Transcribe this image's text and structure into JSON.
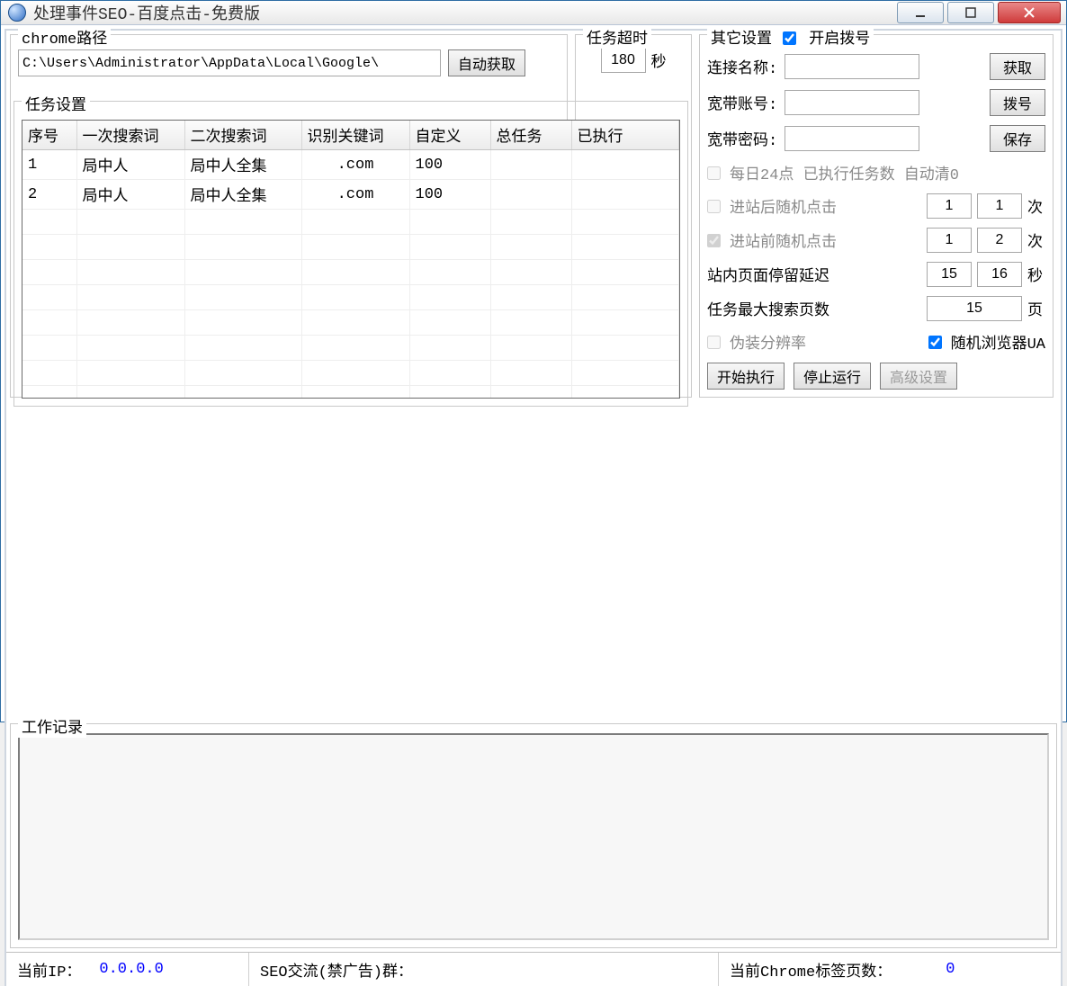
{
  "window": {
    "title": "处理事件SEO-百度点击-免费版"
  },
  "chrome": {
    "legend": "chrome路径",
    "path": "C:\\Users\\Administrator\\AppData\\Local\\Google\\",
    "auto_get": "自动获取"
  },
  "timeout": {
    "legend": "任务超时",
    "value": "180",
    "unit": "秒"
  },
  "other": {
    "legend": "其它设置",
    "enable_dial": "开启拨号",
    "conn_name_label": "连接名称:",
    "get_btn": "获取",
    "bb_account_label": "宽带账号:",
    "dial_btn": "拨号",
    "bb_pwd_label": "宽带密码:",
    "save_btn": "保存",
    "daily24": "每日24点 已执行任务数 自动清0",
    "after_enter_click": "进站后随机点击",
    "after_val1": "1",
    "after_val2": "1",
    "times_unit": "次",
    "before_enter_click": "进站前随机点击",
    "before_val1": "1",
    "before_val2": "2",
    "stay_delay_label": "站内页面停留延迟",
    "stay_val1": "15",
    "stay_val2": "16",
    "sec_unit": "秒",
    "page_unit": "页",
    "max_pages_label": "任务最大搜索页数",
    "max_pages_val": "15",
    "fake_res": "伪装分辨率",
    "random_ua": "随机浏览器UA",
    "start_btn": "开始执行",
    "stop_btn": "停止运行",
    "adv_btn": "高级设置"
  },
  "tasks": {
    "legend": "任务设置",
    "headers": [
      "序号",
      "一次搜索词",
      "二次搜索词",
      "识别关键词",
      "自定义",
      "总任务",
      "已执行"
    ],
    "rows": [
      {
        "no": "1",
        "kw1": "局中人",
        "kw2": "局中人全集",
        "rec": ".com",
        "custom": "100",
        "total": "",
        "done": ""
      },
      {
        "no": "2",
        "kw1": "局中人",
        "kw2": "局中人全集",
        "rec": ".com",
        "custom": "100",
        "total": "",
        "done": ""
      }
    ]
  },
  "log": {
    "legend": "工作记录"
  },
  "status": {
    "ip_label": "当前IP：",
    "ip_value": "0.0.0.0",
    "group_label": "SEO交流(禁广告)群：",
    "tabs_label": "当前Chrome标签页数：",
    "tabs_value": "0"
  }
}
